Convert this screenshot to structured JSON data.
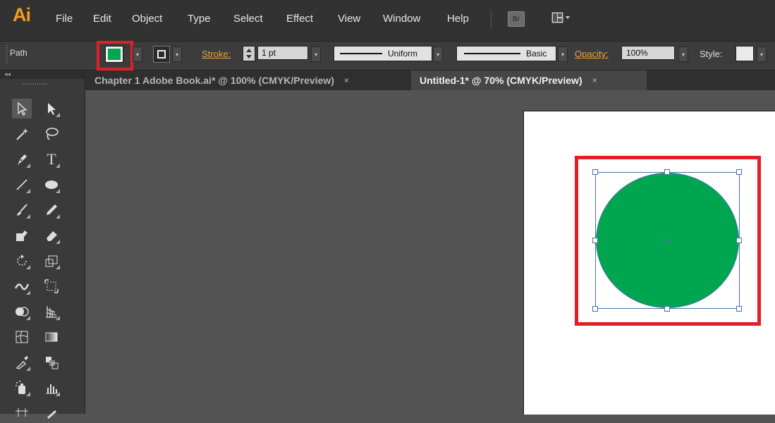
{
  "app": {
    "logo": "Ai"
  },
  "menu": {
    "items": [
      "File",
      "Edit",
      "Object",
      "Type",
      "Select",
      "Effect",
      "View",
      "Window",
      "Help"
    ],
    "bridge_icon_label": "Br"
  },
  "control_bar": {
    "selection_type": "Path",
    "fill_color": "#00a550",
    "stroke_label": "Stroke:",
    "stroke_weight": "1 pt",
    "variable_width_profile": "Uniform",
    "brush_definition": "Basic",
    "opacity_label": "Opacity:",
    "opacity_value": "100%",
    "style_label": "Style:"
  },
  "tabs": [
    {
      "label": "Chapter 1 Adobe Book.ai* @ 100% (CMYK/Preview)",
      "close": "×",
      "active": false
    },
    {
      "label": "Untitled-1* @ 70% (CMYK/Preview)",
      "close": "×",
      "active": true
    }
  ],
  "tools_panel": {
    "collapse_glyph": "◂◂"
  },
  "canvas": {
    "artboard_color": "#ffffff",
    "circle_fill": "#00a550",
    "highlight_color": "#e02027",
    "selection_color": "#4a6fa5"
  },
  "icons": [
    "selection-icon",
    "direct-selection-icon",
    "magic-wand-icon",
    "lasso-icon",
    "pen-icon",
    "type-icon",
    "line-segment-icon",
    "ellipse-icon",
    "paintbrush-icon",
    "pencil-icon",
    "blob-brush-icon",
    "eraser-icon",
    "rotate-icon",
    "scale-icon",
    "width-icon",
    "free-transform-icon",
    "shape-builder-icon",
    "perspective-grid-icon",
    "mesh-icon",
    "gradient-icon",
    "eyedropper-icon",
    "blend-icon",
    "symbol-sprayer-icon",
    "column-graph-icon",
    "artboard-icon",
    "slice-icon"
  ]
}
